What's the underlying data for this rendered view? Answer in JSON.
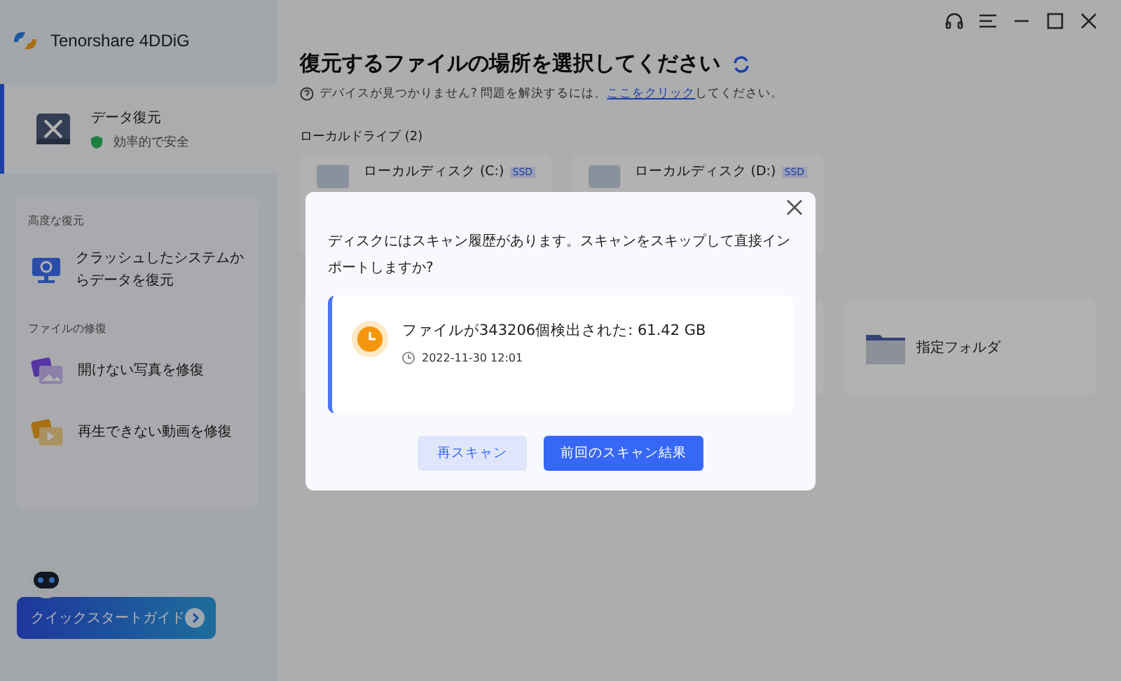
{
  "app": {
    "title": "Tenorshare 4DDiG"
  },
  "sidebar": {
    "main_item": {
      "label": "データ復元",
      "badge": "効率的で安全",
      "selected": true
    },
    "sections": [
      {
        "heading": "高度な復元",
        "items": [
          {
            "label": "クラッシュしたシステムからデータを復元",
            "kind": "system"
          }
        ]
      },
      {
        "heading": "ファイルの修復",
        "items": [
          {
            "label": "開けない写真を修復",
            "kind": "photo"
          },
          {
            "label": "再生できない動画を修復",
            "kind": "video"
          }
        ]
      }
    ],
    "guide_button": "クイックスタートガイド"
  },
  "main": {
    "title": "復元するファイルの場所を選択してください",
    "help_text": "デバイスが見つかりません? 問題を解決するには、",
    "help_link": "ここをクリック",
    "help_tail": "してください。",
    "drives_heading": "ローカルドライブ (2)",
    "drives": [
      {
        "name": "ローカルディスク (C:)",
        "tag": "SSD"
      },
      {
        "name": "ローカルディスク (D:)",
        "tag": "SSD"
      }
    ],
    "folder_card": {
      "label": "指定フォルダ"
    }
  },
  "dialog": {
    "message": "ディスクにはスキャン履歴があります。スキャンをスキップして直接インポートしますか?",
    "result": "ファイルが343206個検出された:  61.42 GB",
    "date": "2022-11-30 12:01",
    "buttons": [
      {
        "label": "再スキャン",
        "kind": "secondary"
      },
      {
        "label": "前回のスキャン結果",
        "kind": "primary"
      }
    ]
  }
}
